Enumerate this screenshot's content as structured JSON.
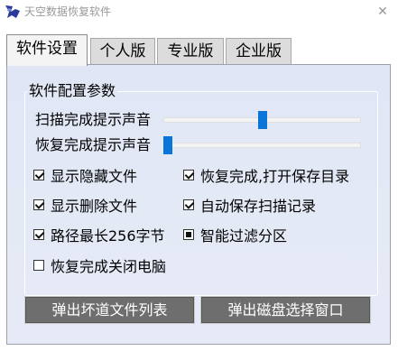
{
  "window": {
    "title": "天空数据恢复软件",
    "close_glyph": "✕"
  },
  "tabs": [
    {
      "label": "软件设置",
      "active": true
    },
    {
      "label": "个人版",
      "active": false
    },
    {
      "label": "专业版",
      "active": false
    },
    {
      "label": "企业版",
      "active": false
    }
  ],
  "settings": {
    "group_title": "软件配置参数",
    "scan_sound_label": "扫描完成提示声音",
    "scan_sound_level": 0.5,
    "recover_sound_label": "恢复完成提示声音",
    "recover_sound_level": 0.0,
    "options": {
      "show_hidden": {
        "label": "显示隐藏文件",
        "state": "checked"
      },
      "open_folder": {
        "label": "恢复完成,打开保存目录",
        "state": "checked"
      },
      "show_deleted": {
        "label": "显示删除文件",
        "state": "checked"
      },
      "auto_save_scan": {
        "label": "自动保存扫描记录",
        "state": "checked"
      },
      "path_max": {
        "label": "路径最长256字节",
        "state": "checked"
      },
      "smart_filter": {
        "label": "智能过滤分区",
        "state": "indeterminate"
      },
      "shutdown": {
        "label": "恢复完成关闭电脑",
        "state": "unchecked"
      }
    }
  },
  "buttons": {
    "bad_track_list": "弹出坏道文件列表",
    "disk_select": "弹出磁盘选择窗口"
  },
  "colors": {
    "panel_bg": "#e2e8f6",
    "slider_thumb": "#0a74d8",
    "button_bg": "#6e6e6e"
  }
}
